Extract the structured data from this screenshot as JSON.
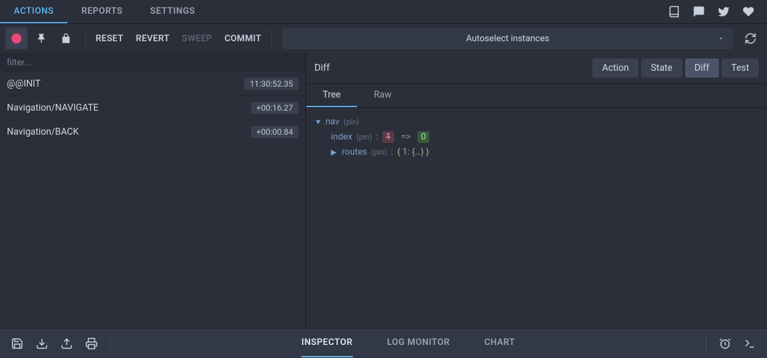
{
  "main_tabs": {
    "actions": "ACTIONS",
    "reports": "REPORTS",
    "settings": "SETTINGS"
  },
  "toolbar": {
    "reset": "RESET",
    "revert": "REVERT",
    "sweep": "SWEEP",
    "commit": "COMMIT"
  },
  "instance_selector": {
    "selected": "Autoselect instances"
  },
  "filter": {
    "placeholder": "filter..."
  },
  "actions_list": [
    {
      "name": "@@INIT",
      "time": "11:30:52.35"
    },
    {
      "name": "Navigation/NAVIGATE",
      "time": "+00:16.27"
    },
    {
      "name": "Navigation/BACK",
      "time": "+00:00.84"
    }
  ],
  "right_panel": {
    "title": "Diff",
    "view_buttons": {
      "action": "Action",
      "state": "State",
      "diff": "Diff",
      "test": "Test"
    },
    "sub_tabs": {
      "tree": "Tree",
      "raw": "Raw"
    }
  },
  "tree": {
    "nav_key": "nav",
    "pin": "(pin)",
    "index_key": "index",
    "index_old": "1",
    "index_arrow": "=>",
    "index_new": "0",
    "routes_key": "routes",
    "routes_preview": "{ 1: {…} }"
  },
  "bottom_tabs": {
    "inspector": "INSPECTOR",
    "log_monitor": "LOG MONITOR",
    "chart": "CHART"
  }
}
